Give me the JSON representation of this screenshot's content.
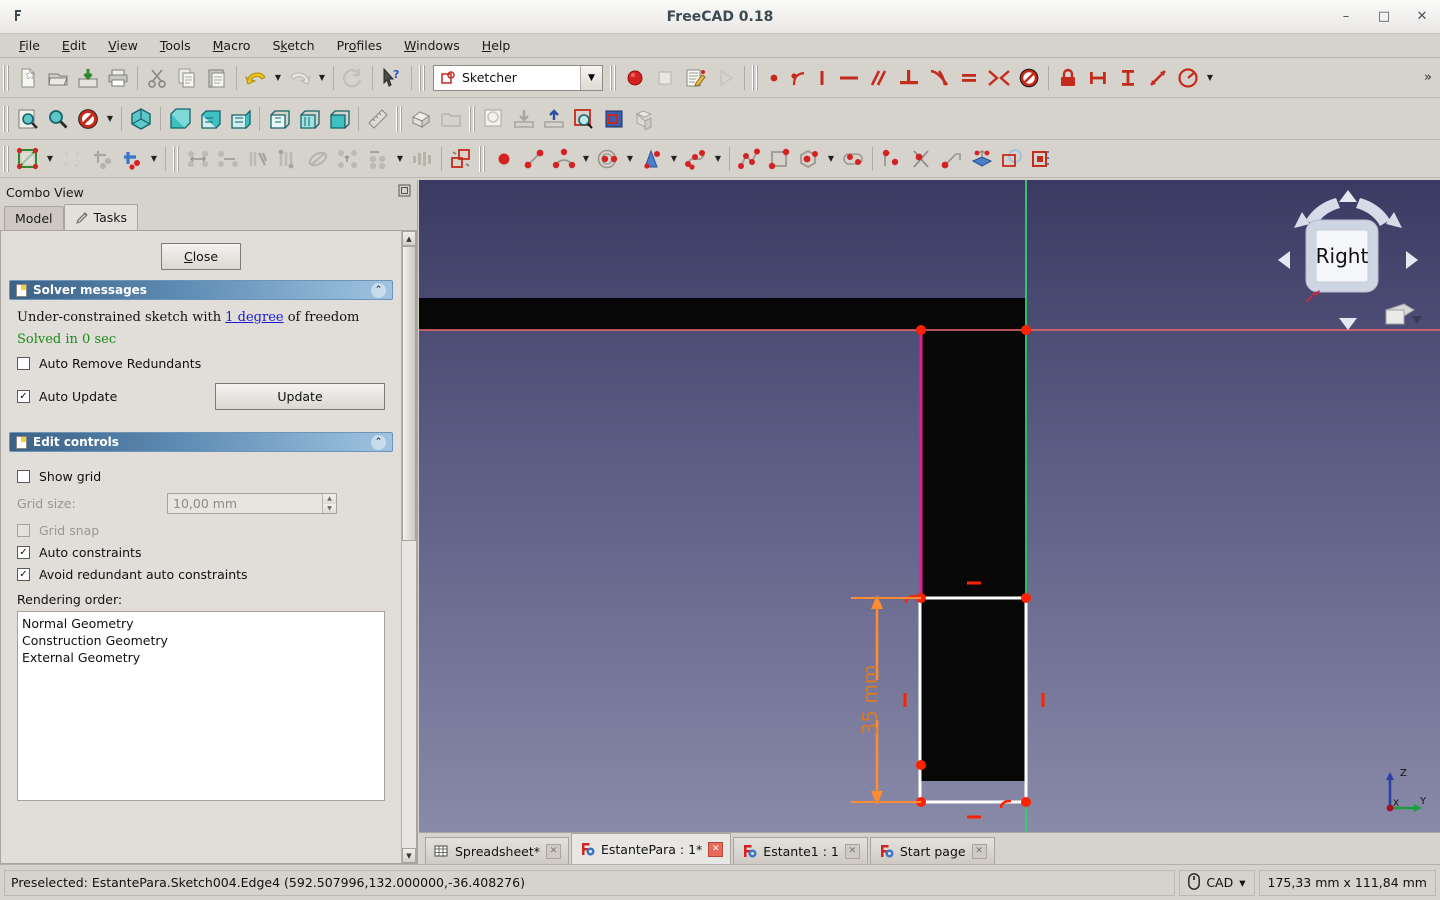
{
  "window": {
    "title": "FreeCAD 0.18",
    "app_icon": "freecad-icon",
    "minimize": "–",
    "maximize": "□",
    "close": "✕"
  },
  "menubar": {
    "items": [
      {
        "label": "File",
        "mnemonic": "F"
      },
      {
        "label": "Edit",
        "mnemonic": "E"
      },
      {
        "label": "View",
        "mnemonic": "V"
      },
      {
        "label": "Tools",
        "mnemonic": "T"
      },
      {
        "label": "Macro",
        "mnemonic": "M"
      },
      {
        "label": "Sketch",
        "mnemonic": "k"
      },
      {
        "label": "Profiles",
        "mnemonic": "o"
      },
      {
        "label": "Windows",
        "mnemonic": "W"
      },
      {
        "label": "Help",
        "mnemonic": "H"
      }
    ]
  },
  "toolbars": {
    "file": [
      "new-document-icon",
      "open-document-icon",
      "save-document-icon",
      "print-icon"
    ],
    "clipboard": [
      "cut-icon",
      "copy-icon",
      "paste-icon"
    ],
    "history": [
      "undo-icon",
      "undo-dropdown-icon",
      "redo-icon",
      "redo-dropdown-icon"
    ],
    "refresh": [
      "refresh-icon"
    ],
    "whatsthis": [
      "whats-this-icon"
    ],
    "workbench": {
      "selected": "Sketcher",
      "icon": "sketcher-workbench-icon",
      "dropdown": "chevron-down-icon"
    },
    "macro": [
      "macro-record-icon",
      "macro-stop-icon",
      "macro-edit-icon",
      "macro-execute-icon"
    ],
    "sketcher_constraints": [
      "constrain-coincident-icon",
      "constrain-point-on-object-icon",
      "constrain-vertical-icon",
      "constrain-horizontal-icon",
      "constrain-parallel-icon",
      "constrain-perpendicular-icon",
      "constrain-tangent-icon",
      "constrain-equal-icon",
      "constrain-symmetric-icon",
      "constrain-block-icon",
      "constrain-lock-icon",
      "constrain-distance-x-icon",
      "constrain-distance-y-icon",
      "constrain-distance-icon",
      "constrain-angle-icon",
      "constrain-more-dropdown-icon"
    ],
    "overflow": "»",
    "view_std": [
      "fit-all-icon",
      "fit-selection-icon",
      "draw-style-icon",
      "draw-style-dropdown-icon"
    ],
    "view_iso": [
      "isometric-view-icon"
    ],
    "view_basic": [
      "front-view-icon",
      "top-view-icon",
      "right-view-icon"
    ],
    "view_rear": [
      "rear-view-icon",
      "bottom-view-icon",
      "left-view-icon"
    ],
    "measure": [
      "measure-distance-icon"
    ],
    "part_ops": [
      "part-shape-icon",
      "folder-icon"
    ],
    "sketch_io": [
      "create-sketch-icon",
      "import-sketch-icon",
      "export-sketch-icon",
      "view-sketch-icon",
      "view-section-icon",
      "map-sketch-icon"
    ],
    "sketcher_visual": [
      "edit-sketch-icon",
      "edit-sketch-dropdown-icon",
      "close-shape-icon",
      "connect-edges-icon",
      "select-constraints-icon",
      "select-dropdown-icon"
    ],
    "sketcher_tools": [
      "select-horiz-constraints-icon",
      "select-vert-constraints-icon",
      "select-elements-associated-icon",
      "select-redundant-icon",
      "select-conflicting-icon",
      "restore-internal-geometry-icon",
      "symmetry-icon",
      "symmetry-dropdown-icon",
      "clone-icon"
    ],
    "sketcher_visibility": [
      "toggle-construction-icon"
    ],
    "sketcher_geometry": [
      "create-point-icon",
      "create-line-icon",
      "create-arc-icon",
      "create-arc-dropdown-icon",
      "create-circle-icon",
      "create-circle-dropdown-icon",
      "create-conic-icon",
      "create-conic-dropdown-icon",
      "create-bspline-icon",
      "create-bspline-dropdown-icon",
      "create-polyline-icon",
      "create-rectangle-icon",
      "create-polygon-icon",
      "create-polygon-dropdown-icon",
      "create-slot-icon"
    ],
    "sketcher_edit": [
      "fillet-icon",
      "trim-edge-icon",
      "extend-edge-icon",
      "external-geometry-icon",
      "carbon-copy-icon",
      "toggle-construction-mode-icon"
    ]
  },
  "combo_view": {
    "title": "Combo View",
    "float_icon": "undock-icon",
    "tabs": [
      {
        "label": "Model",
        "icon": "model-icon",
        "active": false
      },
      {
        "label": "Tasks",
        "icon": "pencil-icon",
        "active": true
      }
    ],
    "close_button": "Close",
    "solver": {
      "header": "Solver messages",
      "header_icon": "note-icon",
      "collapse_icon": "collapse-up-icon",
      "message_prefix": "Under-constrained sketch with ",
      "message_link": "1 degree",
      "message_suffix": " of freedom",
      "solved_text": "Solved in 0 sec",
      "auto_remove_label": "Auto Remove Redundants",
      "auto_remove_checked": false,
      "auto_update_label": "Auto Update",
      "auto_update_checked": true,
      "update_button": "Update"
    },
    "edit_controls": {
      "header": "Edit controls",
      "header_icon": "note-icon",
      "collapse_icon": "collapse-up-icon",
      "show_grid_label": "Show grid",
      "show_grid_checked": false,
      "grid_size_label": "Grid size:",
      "grid_size_value": "10,00 mm",
      "grid_size_disabled": true,
      "grid_snap_label": "Grid snap",
      "grid_snap_checked": false,
      "grid_snap_disabled": true,
      "auto_constraints_label": "Auto constraints",
      "auto_constraints_checked": true,
      "avoid_redundant_label": "Avoid redundant auto constraints",
      "avoid_redundant_checked": true,
      "rendering_order_label": "Rendering order:",
      "rendering_order_items": [
        "Normal Geometry",
        "Construction Geometry",
        "External Geometry"
      ]
    }
  },
  "view_tabs": [
    {
      "label": "Spreadsheet*",
      "icon": "spreadsheet-icon",
      "close": "✕",
      "active": false
    },
    {
      "label": "EstantePara : 1*",
      "icon": "freecad-doc-icon",
      "close": "✕",
      "active": true
    },
    {
      "label": "Estante1 : 1",
      "icon": "freecad-doc-icon",
      "close": "✕",
      "active": false
    },
    {
      "label": "Start page",
      "icon": "freecad-doc-icon",
      "close": "✕",
      "active": false
    }
  ],
  "viewport": {
    "nav_cube_face": "Right",
    "nav_arrow_left": "◀",
    "nav_arrow_right": "▶",
    "nav_arrow_up": "▲",
    "nav_arrow_down": "▼",
    "nav_menu_icon": "▼",
    "axis_x": "X",
    "axis_y": "Y",
    "axis_z": "Z",
    "dimension_label": "35 mm",
    "colors": {
      "background_top": "#3a3a63",
      "background_bottom": "#8d8dab",
      "edge_white": "#ffffff",
      "edge_selected": "#e02080",
      "vertex_red": "#ff2200",
      "constraint_orange": "#ff8c32",
      "axis_x_red": "#f05a5a",
      "axis_y_green": "#35d06a",
      "face_black": "#070707"
    }
  },
  "statusbar": {
    "message": "Preselected: EstantePara.Sketch004.Edge4 (592.507996,132.000000,-36.408276)",
    "nav_icon": "mouse-icon",
    "nav_mode": "CAD",
    "nav_dropdown": "▾",
    "dimensions": "175,33 mm x 111,84 mm"
  }
}
